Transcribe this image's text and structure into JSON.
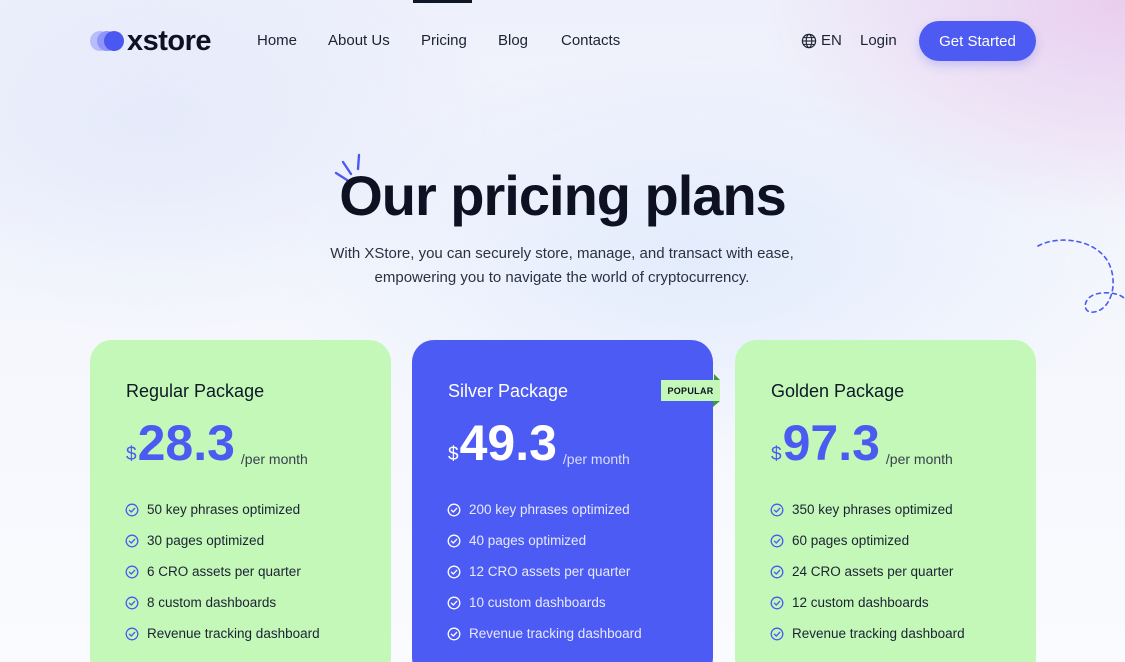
{
  "brand": {
    "name": "xstore"
  },
  "nav": {
    "items": [
      "Home",
      "About Us",
      "Pricing",
      "Blog",
      "Contacts"
    ],
    "active": "Pricing",
    "language": "EN",
    "login": "Login",
    "cta": "Get Started"
  },
  "hero": {
    "title": "Our pricing plans",
    "subtitle_line1": "With XStore, you can securely store, manage, and transact with ease,",
    "subtitle_line2": "empowering you to navigate the world of cryptocurrency."
  },
  "plans": [
    {
      "name": "Regular Package",
      "currency": "$",
      "price": "28.3",
      "period": "/per month",
      "badge": "",
      "features": [
        "50 key phrases optimized",
        "30 pages optimized",
        "6 CRO assets per quarter",
        "8 custom dashboards",
        "Revenue tracking dashboard"
      ]
    },
    {
      "name": "Silver Package",
      "currency": "$",
      "price": "49.3",
      "period": "/per month",
      "badge": "POPULAR",
      "features": [
        "200 key phrases optimized",
        "40 pages optimized",
        "12 CRO assets per quarter",
        "10 custom dashboards",
        "Revenue tracking dashboard"
      ]
    },
    {
      "name": "Golden Package",
      "currency": "$",
      "price": "97.3",
      "period": "/per month",
      "badge": "",
      "features": [
        "350 key phrases optimized",
        "60 pages optimized",
        "24 CRO assets per quarter",
        "12 custom dashboards",
        "Revenue tracking dashboard"
      ]
    }
  ],
  "colors": {
    "accent": "#4e5bf2",
    "card_green": "#c3f8b8",
    "card_blue": "#4c5bf4",
    "text_dark": "#0d1122"
  },
  "icons": {
    "globe": "globe-icon",
    "check": "check-circle-icon",
    "sparks": "sparkle-lines-icon",
    "swirl": "dashed-swirl-decoration"
  }
}
